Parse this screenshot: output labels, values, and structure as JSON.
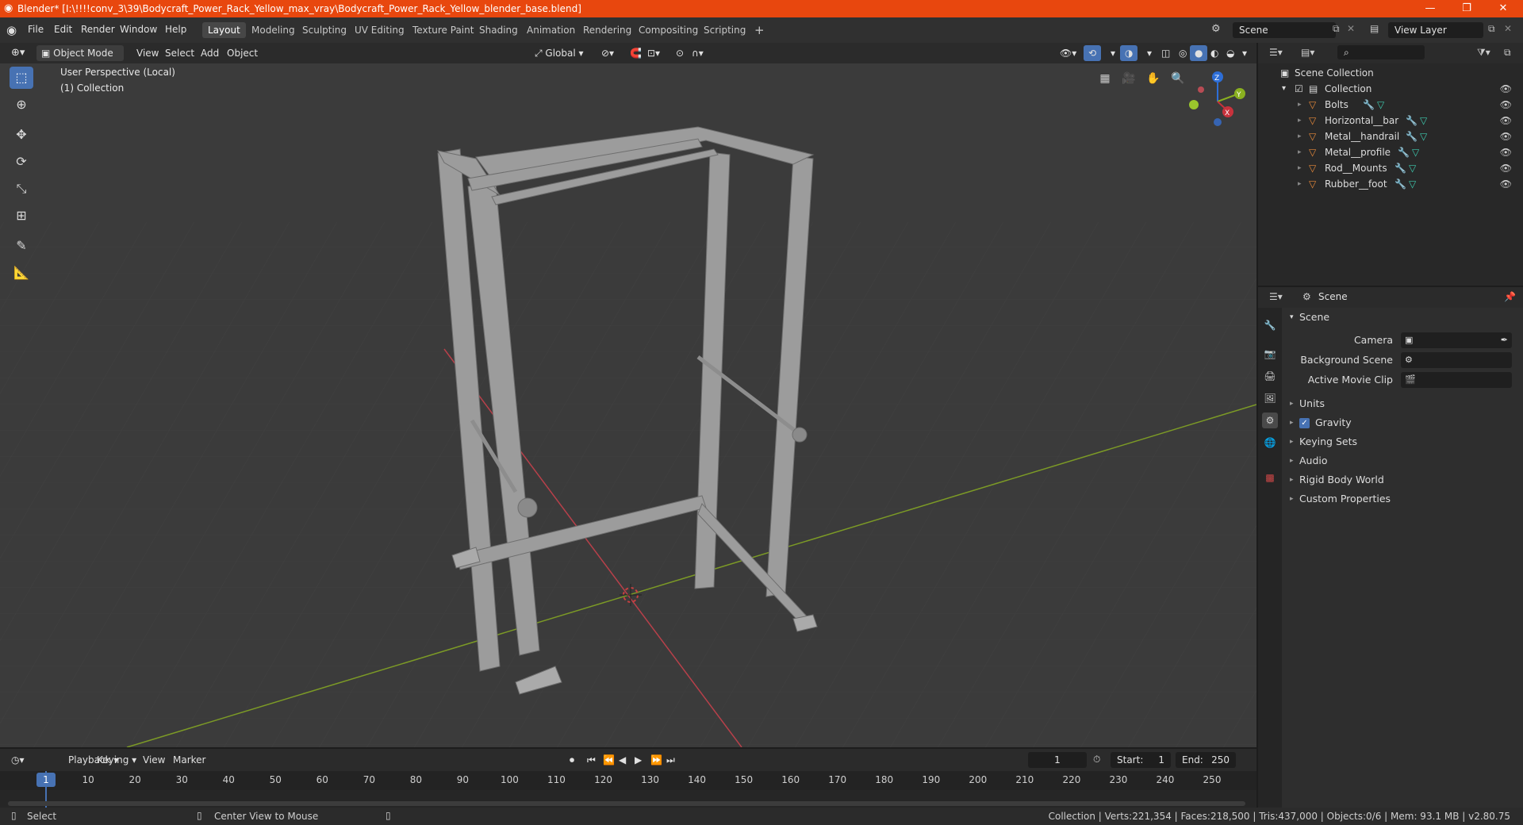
{
  "titlebar": {
    "title": "Blender* [I:\\!!!!conv_3\\39\\Bodycraft_Power_Rack_Yellow_max_vray\\Bodycraft_Power_Rack_Yellow_blender_base.blend]",
    "minimize": "—",
    "maximize": "❐",
    "close": "✕"
  },
  "menubar": {
    "items": [
      "File",
      "Edit",
      "Render",
      "Window",
      "Help"
    ],
    "workspaces": [
      "Layout",
      "Modeling",
      "Sculpting",
      "UV Editing",
      "Texture Paint",
      "Shading",
      "Animation",
      "Rendering",
      "Compositing",
      "Scripting"
    ],
    "active_workspace": "Layout",
    "add_tab": "+",
    "scene": "Scene",
    "view_layer": "View Layer"
  },
  "viewport_header": {
    "mode": "Object Mode",
    "menus": [
      "View",
      "Select",
      "Add",
      "Object"
    ],
    "orientation": "Global"
  },
  "viewport": {
    "perspective": "User Perspective (Local)",
    "collection": "(1) Collection",
    "gizmo": {
      "x": "X",
      "y": "Y",
      "z": "Z"
    },
    "colors": {
      "x_axis": "#c8323c",
      "y_axis": "#8ab020",
      "z_axis": "#2d6ed7",
      "model": "#9a9a9a"
    }
  },
  "outliner": {
    "root": "Scene Collection",
    "collection": "Collection",
    "objects": [
      "Bolts",
      "Horizontal__bar",
      "Metal__handrail",
      "Metal__profile",
      "Rod__Mounts",
      "Rubber__foot"
    ]
  },
  "properties": {
    "context": "Scene",
    "panel": "Scene",
    "fields": [
      {
        "label": "Camera",
        "value": ""
      },
      {
        "label": "Background Scene",
        "value": ""
      },
      {
        "label": "Active Movie Clip",
        "value": ""
      }
    ],
    "sections": [
      {
        "label": "Units",
        "checkbox": false
      },
      {
        "label": "Gravity",
        "checkbox": true
      },
      {
        "label": "Keying Sets",
        "checkbox": false
      },
      {
        "label": "Audio",
        "checkbox": false
      },
      {
        "label": "Rigid Body World",
        "checkbox": false
      },
      {
        "label": "Custom Properties",
        "checkbox": false
      }
    ]
  },
  "timeline": {
    "menus": [
      "Playback",
      "Keying",
      "View",
      "Marker"
    ],
    "current_frame": "1",
    "start_label": "Start:",
    "start": "1",
    "end_label": "End:",
    "end": "250",
    "ticks": [
      "1",
      "10",
      "20",
      "30",
      "40",
      "50",
      "60",
      "70",
      "80",
      "90",
      "100",
      "110",
      "120",
      "130",
      "140",
      "150",
      "160",
      "170",
      "180",
      "190",
      "200",
      "210",
      "220",
      "230",
      "240",
      "250"
    ]
  },
  "statusbar": {
    "left": "Select",
    "middle": "Center View to Mouse",
    "right": "Collection | Verts:221,354 | Faces:218,500 | Tris:437,000 | Objects:0/6 | Mem: 93.1 MB | v2.80.75"
  }
}
